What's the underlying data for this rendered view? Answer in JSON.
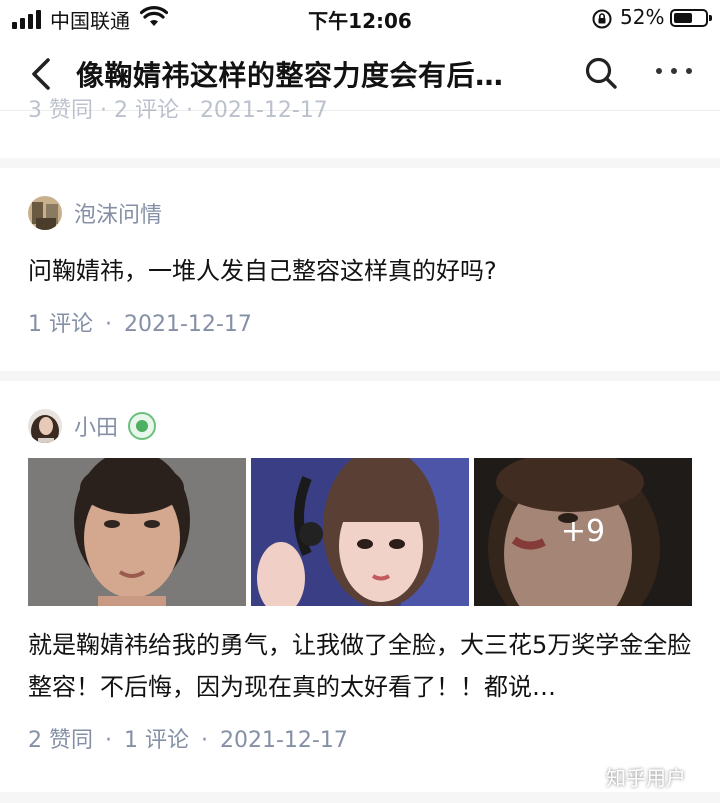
{
  "status_bar": {
    "carrier": "中国联通",
    "time": "下午12:06",
    "battery": "52%"
  },
  "nav": {
    "title": "像鞠婧祎这样的整容力度会有后…",
    "icons": {
      "back": "chevron-left-icon",
      "search": "search-icon",
      "more": "more-icon"
    }
  },
  "feed": {
    "prev_meta": "3 赞同  ·  2 评论  ·  2021-12-17",
    "items": [
      {
        "author": "泡沫问情",
        "text": "问鞠婧祎，一堆人发自己整容这样真的好吗?",
        "meta": {
          "comments": "1 评论",
          "date": "2021-12-17"
        }
      },
      {
        "author": "小田",
        "text": "就是鞠婧祎给我的勇气，让我做了全脸，大三花5万奖学金全脸整容！不后悔，因为现在真的太好看了！！都说…",
        "images_more": "+9",
        "meta": {
          "likes": "2 赞同",
          "comments": "1 评论",
          "date": "2021-12-17"
        }
      }
    ]
  },
  "watermark": "知乎用户",
  "colors": {
    "meta_gray": "#8590a6",
    "text": "#121212",
    "separator": "#f6f6f6",
    "badge_green": "#4caf62"
  }
}
